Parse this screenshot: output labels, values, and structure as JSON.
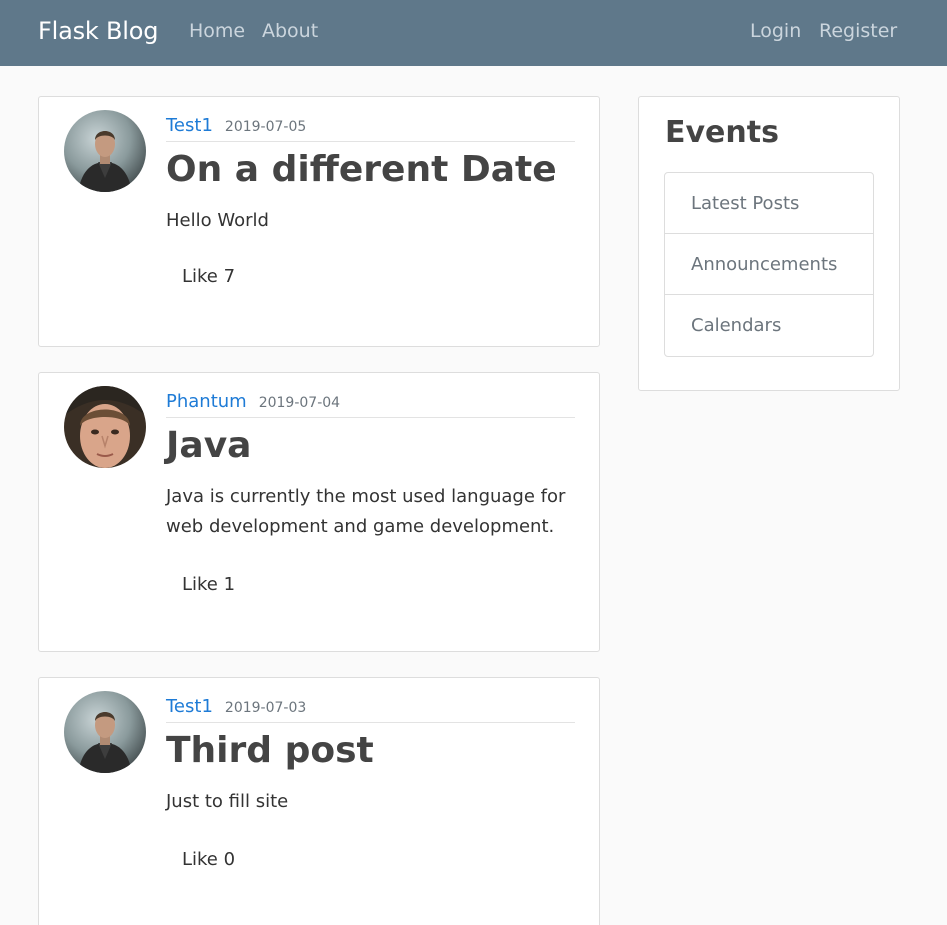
{
  "navbar": {
    "brand": "Flask Blog",
    "links_left": [
      "Home",
      "About"
    ],
    "links_right": [
      "Login",
      "Register"
    ],
    "background": "#5f788a"
  },
  "posts": [
    {
      "author": "Test1",
      "date": "2019-07-05",
      "title": "On a different Date",
      "content": "Hello World",
      "like": "Like 7",
      "avatar": "avatar-test1-image"
    },
    {
      "author": "Phantum",
      "date": "2019-07-04",
      "title": "Java",
      "content": "Java is currently the most used language for web development and game development.",
      "like": "Like 1",
      "avatar": "avatar-phantum-image"
    },
    {
      "author": "Test1",
      "date": "2019-07-03",
      "title": "Third post",
      "content": "Just to fill site",
      "like": "Like 0",
      "avatar": "avatar-test1-image"
    }
  ],
  "sidebar": {
    "title": "Events",
    "items": [
      "Latest Posts",
      "Announcements",
      "Calendars"
    ]
  },
  "colors": {
    "author_link": "#1e7bd6",
    "page_background": "#fafafa"
  }
}
